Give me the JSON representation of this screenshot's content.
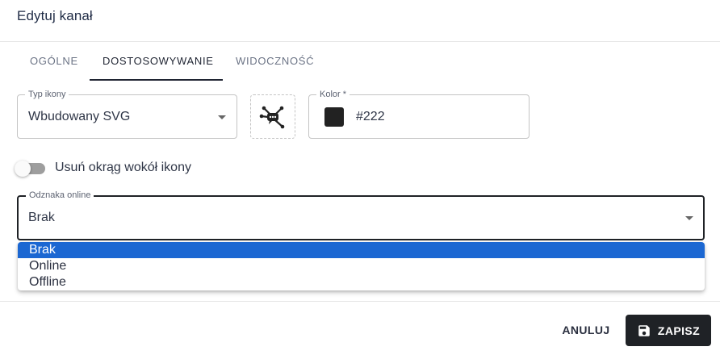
{
  "dialog": {
    "title": "Edytuj kanał"
  },
  "tabs": [
    {
      "label": "OGÓLNE",
      "active": false
    },
    {
      "label": "DOSTOSOWYWANIE",
      "active": true
    },
    {
      "label": "WIDOCZNOŚĆ",
      "active": false
    }
  ],
  "icon_type": {
    "label": "Typ ikony",
    "value": "Wbudowany SVG"
  },
  "icon_picker": {
    "icon": "network-chat-icon"
  },
  "color": {
    "label": "Kolor *",
    "value": "#222",
    "swatch": "#222222"
  },
  "circle_toggle": {
    "label": "Usuń okrąg wokół ikony",
    "checked": false
  },
  "online_badge": {
    "label": "Odznaka online",
    "value": "Brak",
    "options": [
      "Brak",
      "Online",
      "Offline"
    ],
    "highlighted": "Brak"
  },
  "actions": {
    "cancel": "ANULUJ",
    "save": "ZAPISZ",
    "save_icon": "floppy-disk-icon"
  },
  "colors": {
    "accent": "#1b67d2",
    "primary": "#1f2226",
    "title": "#1f2b45"
  }
}
